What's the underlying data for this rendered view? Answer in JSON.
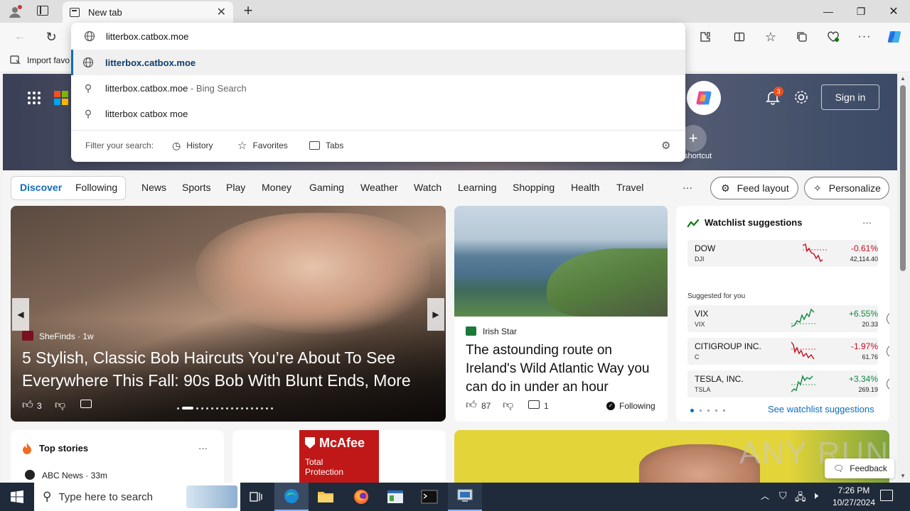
{
  "browser": {
    "tab_title": "New tab",
    "address_value": "litterbox.catbox.moe",
    "favorites_import_label": "Import favo"
  },
  "omnibox": {
    "suggestions": [
      {
        "text": "litterbox.catbox.moe",
        "suffix": "",
        "icon": "globe-icon"
      },
      {
        "text": "litterbox.catbox.moe",
        "suffix": " - Bing Search",
        "icon": "search-icon"
      },
      {
        "text": "litterbox catbox moe",
        "suffix": "",
        "icon": "search-icon"
      }
    ],
    "filter_label": "Filter your search:",
    "filters": [
      "History",
      "Favorites",
      "Tabs"
    ]
  },
  "header": {
    "notification_count": "3",
    "sign_in": "Sign in",
    "shortcut_label": "shortcut"
  },
  "nav": {
    "discover": "Discover",
    "following": "Following",
    "categories": [
      "News",
      "Sports",
      "Play",
      "Money",
      "Gaming",
      "Weather",
      "Watch",
      "Learning",
      "Shopping",
      "Health",
      "Travel"
    ],
    "more": "···",
    "feed_layout": "Feed layout",
    "personalize": "Personalize"
  },
  "hero_article": {
    "source": "SheFinds",
    "age": "1w",
    "title": "5 Stylish, Classic Bob Haircuts You’re About To See Everywhere This Fall: 90s Bob With Blunt Ends, More",
    "likes": "3"
  },
  "second_article": {
    "source": "Irish Star",
    "title": "The astounding route on Ireland's Wild Atlantic Way you can do in under an hour",
    "likes": "87",
    "comments": "1",
    "following": "Following"
  },
  "watchlist": {
    "title": "Watchlist suggestions",
    "more": "···",
    "primary": {
      "name": "DOW",
      "ticker": "DJI",
      "change": "-0.61%",
      "price": "42,114.40",
      "trend": "down"
    },
    "suggested_label": "Suggested for you",
    "suggested": [
      {
        "name": "VIX",
        "ticker": "VIX",
        "change": "+6.55%",
        "price": "20.33",
        "trend": "up"
      },
      {
        "name": "CITIGROUP INC.",
        "ticker": "C",
        "change": "-1.97%",
        "price": "61.76",
        "trend": "down"
      },
      {
        "name": "TESLA, INC.",
        "ticker": "TSLA",
        "change": "+3.34%",
        "price": "269.19",
        "trend": "up"
      }
    ],
    "see_more": "See watchlist suggestions"
  },
  "top_stories": {
    "title": "Top stories",
    "more": "···",
    "first_source": "ABC News · 33m"
  },
  "ad": {
    "brand": "McAfee",
    "line1": "Total",
    "line2": "Protection"
  },
  "feedback": "Feedback",
  "watermark": "ANY RUN",
  "taskbar": {
    "search_placeholder": "Type here to search",
    "time": "7:26 PM",
    "date": "10/27/2024"
  },
  "colors": {
    "accent": "#0f6cbd",
    "positive": "#0b8a3e",
    "negative": "#c50f1f",
    "taskbar": "#1f2a3a"
  }
}
